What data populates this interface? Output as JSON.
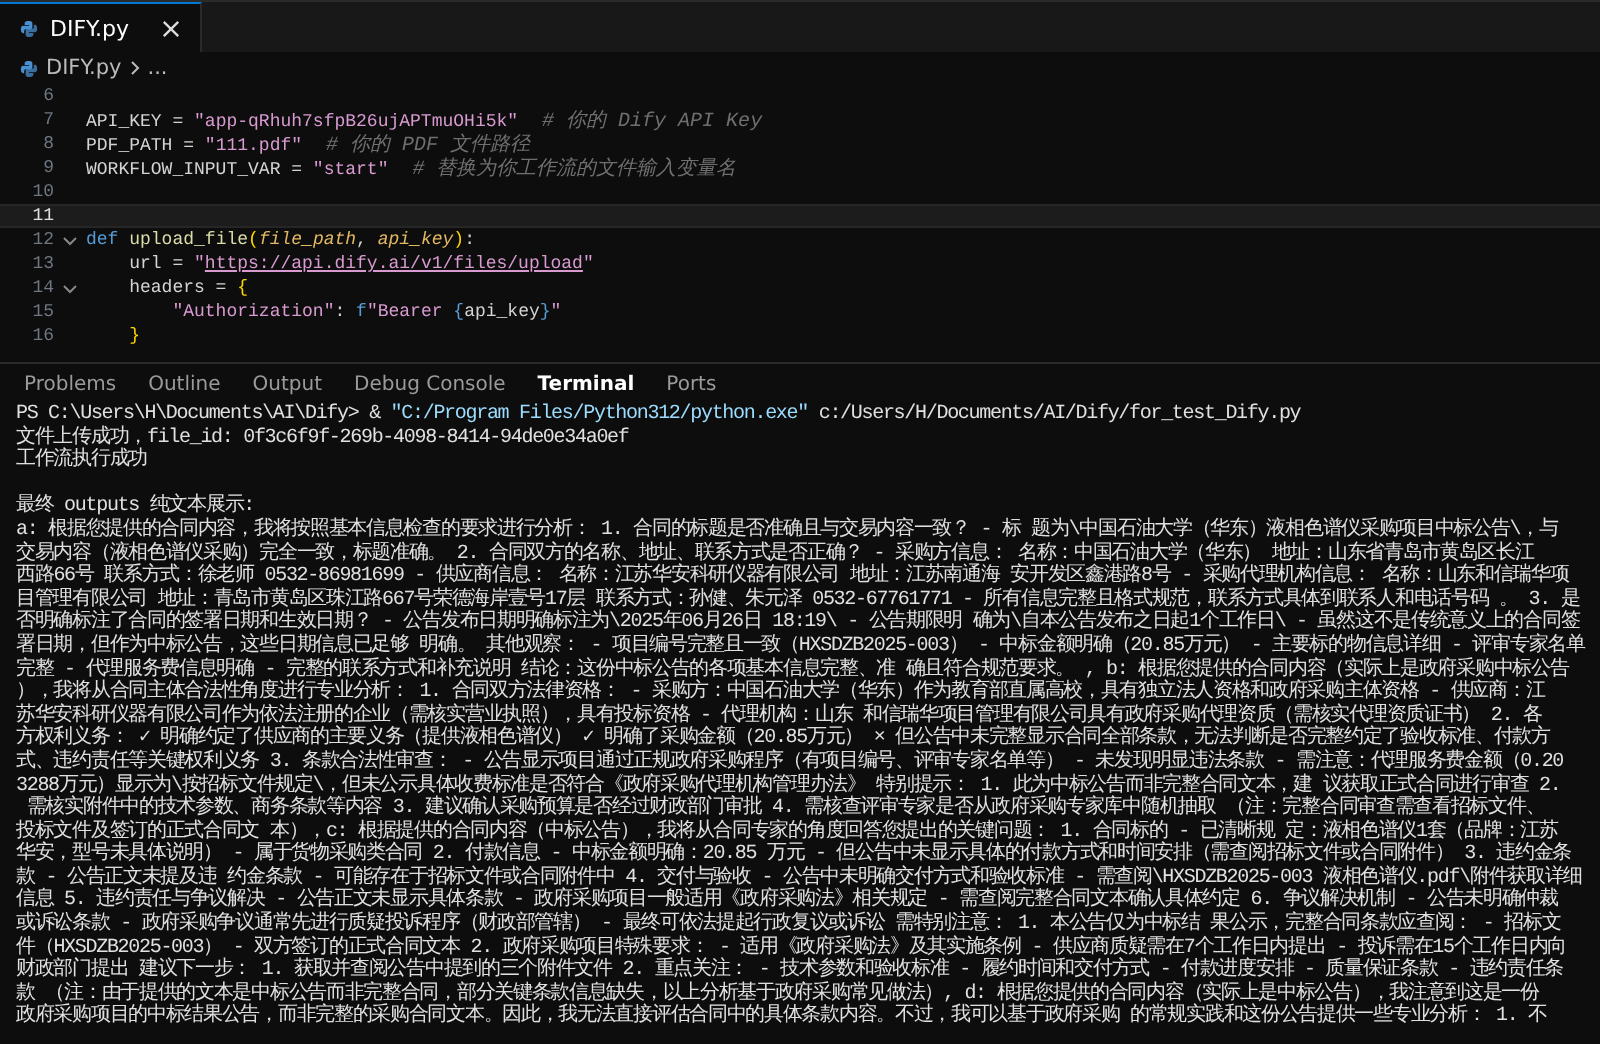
{
  "editor": {
    "tabs": [
      {
        "label": "DIFY.py",
        "selected": true
      }
    ],
    "breadcrumb": [
      "DIFY.py",
      "..."
    ],
    "lines": [
      {
        "number": "6",
        "current": false,
        "foldable": false
      },
      {
        "number": "7",
        "current": false,
        "foldable": false,
        "tokens": [
          {
            "kind": "plain",
            "text": "API_KEY = "
          },
          {
            "kind": "string",
            "text": "\"app-qRhuh7sfpB26ujAPTmuOHi5k\""
          },
          {
            "kind": "comment",
            "text": "  # 你的 Dify API Key"
          }
        ]
      },
      {
        "number": "8",
        "current": false,
        "foldable": false,
        "tokens": [
          {
            "kind": "plain",
            "text": "PDF_PATH = "
          },
          {
            "kind": "string",
            "text": "\"111.pdf\""
          },
          {
            "kind": "comment",
            "text": "  # 你的 PDF 文件路径"
          }
        ]
      },
      {
        "number": "9",
        "current": false,
        "foldable": false,
        "tokens": [
          {
            "kind": "plain",
            "text": "WORKFLOW_INPUT_VAR = "
          },
          {
            "kind": "string",
            "text": "\"start\""
          },
          {
            "kind": "comment",
            "text": "  # 替换为你工作流的文件输入变量名"
          }
        ]
      },
      {
        "number": "10",
        "current": false,
        "foldable": false
      },
      {
        "number": "11",
        "current": true,
        "foldable": false
      },
      {
        "number": "12",
        "current": false,
        "foldable": true,
        "tokens": [
          {
            "kind": "keyword",
            "text": "def "
          },
          {
            "kind": "function",
            "text": "upload_file"
          },
          {
            "kind": "bracket",
            "text": "("
          },
          {
            "kind": "param",
            "text": "file_path"
          },
          {
            "kind": "plain",
            "text": ", "
          },
          {
            "kind": "param",
            "text": "api_key"
          },
          {
            "kind": "bracket",
            "text": ")"
          },
          {
            "kind": "plain",
            "text": ":"
          }
        ]
      },
      {
        "number": "13",
        "current": false,
        "foldable": false,
        "tokens": [
          {
            "kind": "plain",
            "text": "    url = "
          },
          {
            "kind": "string",
            "text": "\""
          },
          {
            "kind": "link",
            "text": "https://api.dify.ai/v1/files/upload"
          },
          {
            "kind": "string",
            "text": "\""
          }
        ]
      },
      {
        "number": "14",
        "current": false,
        "foldable": true,
        "tokens": [
          {
            "kind": "plain",
            "text": "    headers = "
          },
          {
            "kind": "bracket",
            "text": "{"
          }
        ]
      },
      {
        "number": "15",
        "current": false,
        "foldable": false,
        "tokens": [
          {
            "kind": "string",
            "text": "        \"Authorization\""
          },
          {
            "kind": "plain",
            "text": ": "
          },
          {
            "kind": "keyword",
            "text": "f"
          },
          {
            "kind": "string",
            "text": "\"Bearer "
          },
          {
            "kind": "keyword",
            "text": "{"
          },
          {
            "kind": "plain",
            "text": "api_key"
          },
          {
            "kind": "keyword",
            "text": "}"
          },
          {
            "kind": "string",
            "text": "\""
          }
        ]
      },
      {
        "number": "16",
        "current": false,
        "foldable": false,
        "tokens": [
          {
            "kind": "bracket",
            "text": "    }"
          }
        ]
      }
    ]
  },
  "panel": {
    "tabs": [
      {
        "label": "Problems",
        "selected": false
      },
      {
        "label": "Outline",
        "selected": false
      },
      {
        "label": "Output",
        "selected": false
      },
      {
        "label": "Debug Console",
        "selected": false
      },
      {
        "label": "Terminal",
        "selected": true
      },
      {
        "label": "Ports",
        "selected": false
      }
    ],
    "terminal": [
      {
        "kind": "command",
        "segments": [
          {
            "kind": "plain",
            "text": "PS C:\\Users\\H\\Documents\\AI\\Dify> & "
          },
          {
            "kind": "string",
            "text": "\"C:/Program Files/Python312/python.exe\""
          },
          {
            "kind": "plain",
            "text": " c:/Users/H/Documents/AI/Dify/for_test_Dify.py"
          }
        ]
      },
      {
        "kind": "output",
        "text": "文件上传成功，file_id: 0f3c6f9f-269b-4098-8414-94de0e34a0ef"
      },
      {
        "kind": "output",
        "text": "工作流执行成功"
      },
      {
        "kind": "blank"
      },
      {
        "kind": "output",
        "text": "最终 outputs 纯文本展示:"
      },
      {
        "kind": "output",
        "text": "a: 根据您提供的合同内容，我将按照基本信息检查的要求进行分析： 1. 合同的标题是否准确且与交易内容一致？ - 标 题为\\中国石油大学（华东）液相色谱仪采购项目中标公告\\，与"
      },
      {
        "kind": "output",
        "text": "交易内容（液相色谱仪采购）完全一致，标题准确。 2. 合同双方的名称、地址、联系方式是否正确？ - 采购方信息： 名称：中国石油大学（华东） 地址：山东省青岛市黄岛区长江"
      },
      {
        "kind": "output",
        "text": "西路66号 联系方式：徐老师 0532-86981699 - 供应商信息： 名称：江苏华安科研仪器有限公司 地址：江苏南通海 安开发区鑫港路8号 - 采购代理机构信息： 名称：山东和信瑞华项"
      },
      {
        "kind": "output",
        "text": "目管理有限公司 地址：青岛市黄岛区珠江路667号荣德海岸壹号17层 联系方式：孙健、朱元泽 0532-67761771 - 所有信息完整且格式规范，联系方式具体到联系人和电话号码 。 3. 是"
      },
      {
        "kind": "output",
        "text": "否明确标注了合同的签署日期和生效日期？ - 公告发布日期明确标注为\\2025年06月26日 18:19\\ - 公告期限明 确为\\自本公告发布之日起1个工作日\\ - 虽然这不是传统意义上的合同签"
      },
      {
        "kind": "output",
        "text": "署日期，但作为中标公告，这些日期信息已足够 明确。 其他观察： - 项目编号完整且一致（HXSDZB2025-003） - 中标金额明确（20.85万元） - 主要标的物信息详细 - 评审专家名单"
      },
      {
        "kind": "output",
        "text": "完整 - 代理服务费信息明确 - 完整的联系方式和补充说明 结论：这份中标公告的各项基本信息完整、准 确且符合规范要求。 , b: 根据您提供的合同内容（实际上是政府采购中标公告"
      },
      {
        "kind": "output",
        "text": "），我将从合同主体合法性角度进行专业分析： 1. 合同双方法律资格： - 采购方：中国石油大学（华东）作为教育部直属高校，具有独立法人资格和政府采购主体资格 - 供应商：江"
      },
      {
        "kind": "output",
        "text": "苏华安科研仪器有限公司作为依法注册的企业（需核实营业执照），具有投标资格 - 代理机构：山东 和信瑞华项目管理有限公司具有政府采购代理资质（需核实代理资质证书） 2. 各"
      },
      {
        "kind": "output",
        "text": "方权利义务： ✓ 明确约定了供应商的主要义务（提供液相色谱仪） ✓ 明确了采购金额（20.85万元） × 但公告中未完整显示合同全部条款，无法判断是否完整约定了验收标准、付款方"
      },
      {
        "kind": "output",
        "text": "式、违约责任等关键权利义务 3. 条款合法性审查： - 公告显示项目通过正规政府采购程序（有项目编号、评审专家名单等） - 未发现明显违法条款 - 需注意：代理服务费金额（0.20"
      },
      {
        "kind": "output",
        "text": "3288万元）显示为\\按招标文件规定\\，但未公示具体收费标准是否符合《政府采购代理机构管理办法》 特别提示： 1. 此为中标公告而非完整合同文本，建 议获取正式合同进行审查 2."
      },
      {
        "kind": "output",
        "text": " 需核实附件中的技术参数、商务条款等内容 3. 建议确认采购预算是否经过财政部门审批 4. 需核查评审专家是否从政府采购专家库中随机抽取 （注：完整合同审查需查看招标文件、"
      },
      {
        "kind": "output",
        "text": "投标文件及签订的正式合同文 本），c: 根据提供的合同内容（中标公告），我将从合同专家的角度回答您提出的关键问题： 1. 合同标的 - 已清晰规 定：液相色谱仪1套（品牌：江苏"
      },
      {
        "kind": "output",
        "text": "华安，型号未具体说明） - 属于货物采购类合同 2. 付款信息 - 中标金额明确：20.85 万元 - 但公告中未显示具体的付款方式和时间安排（需查阅招标文件或合同附件） 3. 违约金条"
      },
      {
        "kind": "output",
        "text": "款 - 公告正文未提及违 约金条款 - 可能存在于招标文件或合同附件中 4. 交付与验收 - 公告中未明确交付方式和验收标准 - 需查阅\\HXSDZB2025-003 液相色谱仪.pdf\\附件获取详细"
      },
      {
        "kind": "output",
        "text": "信息 5. 违约责任与争议解决 - 公告正文未显示具体条款 - 政府采购项目一般适用《政府采购法》相关规定 - 需查阅完整合同文本确认具体约定 6. 争议解决机制 - 公告未明确仲裁"
      },
      {
        "kind": "output",
        "text": "或诉讼条款 - 政府采购争议通常先进行质疑投诉程序（财政部管辖） - 最终可依法提起行政复议或诉讼 需特别注意： 1. 本公告仅为中标结 果公示，完整合同条款应查阅： - 招标文"
      },
      {
        "kind": "output",
        "text": "件（HXSDZB2025-003） - 双方签订的正式合同文本 2. 政府采购项目特殊要求： - 适用《政府采购法》及其实施条例 - 供应商质疑需在7个工作日内提出 - 投诉需在15个工作日内向"
      },
      {
        "kind": "output",
        "text": "财政部门提出 建议下一步： 1. 获取并查阅公告中提到的三个附件文件 2. 重点关注： - 技术参数和验收标准 - 履约时间和交付方式 - 付款进度安排 - 质量保证条款 - 违约责任条"
      },
      {
        "kind": "output",
        "text": "款 （注：由于提供的文本是中标公告而非完整合同，部分关键条款信息缺失，以上分析基于政府采购常见做法）, d: 根据您提供的合同内容（实际上是中标公告），我注意到这是一份"
      },
      {
        "kind": "output",
        "text": "政府采购项目的中标结果公告，而非完整的采购合同文本。因此，我无法直接评估合同中的具体条款内容。不过，我可以基于政府采购 的常规实践和这份公告提供一些专业分析： 1. 不"
      }
    ]
  }
}
